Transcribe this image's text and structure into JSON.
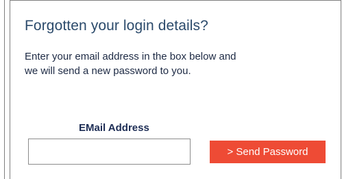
{
  "form": {
    "title": "Forgotten your login details?",
    "description": "Enter your email address in the box below and we will send a new password to you.",
    "email_label": "EMail Address",
    "email_value": "",
    "send_button_label": "> Send Password"
  },
  "colors": {
    "title": "#2b4a6b",
    "button_background": "#ee4b35",
    "border": "#7f7f7f"
  }
}
